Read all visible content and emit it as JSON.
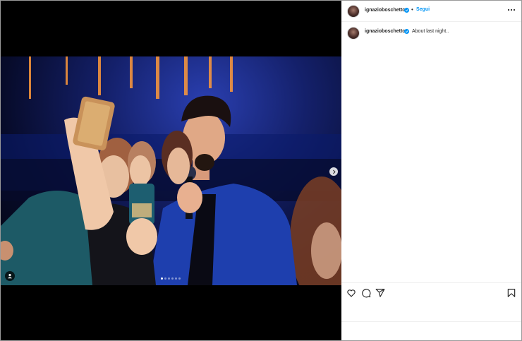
{
  "post": {
    "username": "ignazioboschetto",
    "separator": "•",
    "follow_label": "Segui",
    "caption": "About last night..",
    "carousel": {
      "total_slides": 6,
      "active_index": 0
    }
  },
  "icons": {
    "verified": "verified-badge-icon",
    "more": "more-options-icon",
    "like": "heart-icon",
    "comment": "comment-icon",
    "share": "share-icon",
    "save": "bookmark-icon",
    "next": "chevron-right-icon",
    "tag": "user-tag-icon"
  },
  "colors": {
    "accent": "#0095f6",
    "verified": "#0095f6",
    "text": "#262626",
    "media_background": "#000000"
  }
}
